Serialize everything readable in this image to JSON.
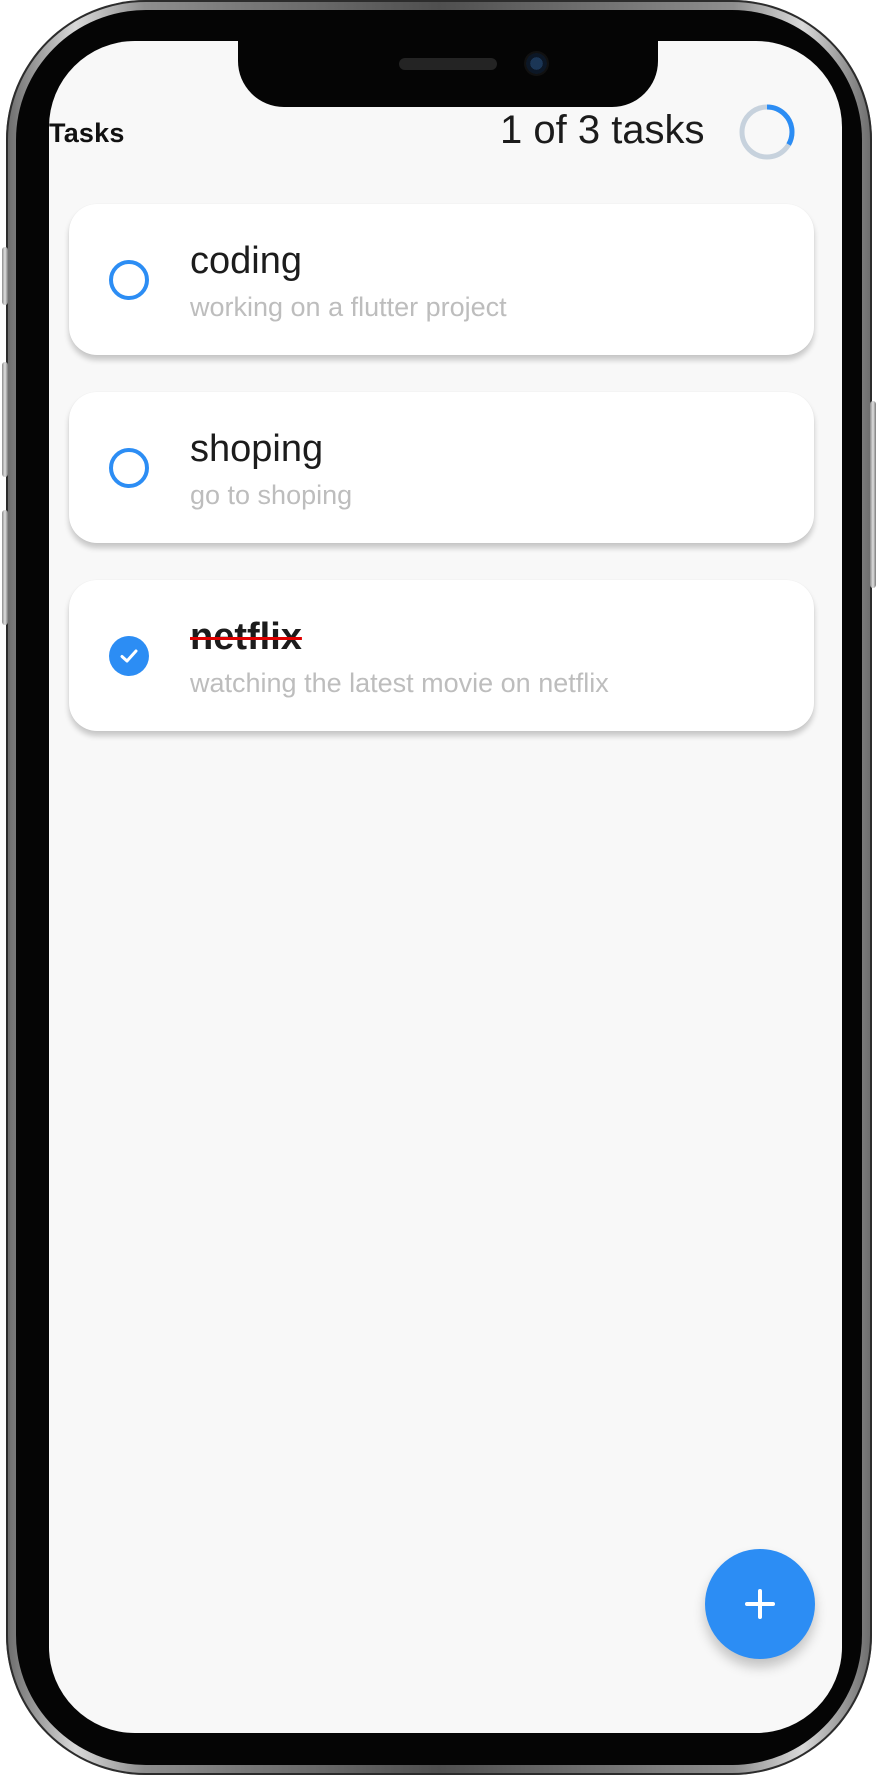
{
  "screen": {
    "header": {
      "title": "Tasks",
      "task_count": "1 of 3 tasks",
      "progress": 0.333
    },
    "tasks": [
      {
        "title": "coding",
        "description": "working on a flutter project",
        "completed": false
      },
      {
        "title": "shoping",
        "description": "go to shoping",
        "completed": false
      },
      {
        "title": "netflix",
        "description": "watching the latest movie on netflix",
        "completed": true
      }
    ],
    "fab": {
      "icon": "plus-icon"
    }
  },
  "colors": {
    "accent": "#2c8df4",
    "card": "#ffffff",
    "screen": "#f8f8f8",
    "progress_track": "#c7d2dd",
    "strike": "#e00000"
  }
}
